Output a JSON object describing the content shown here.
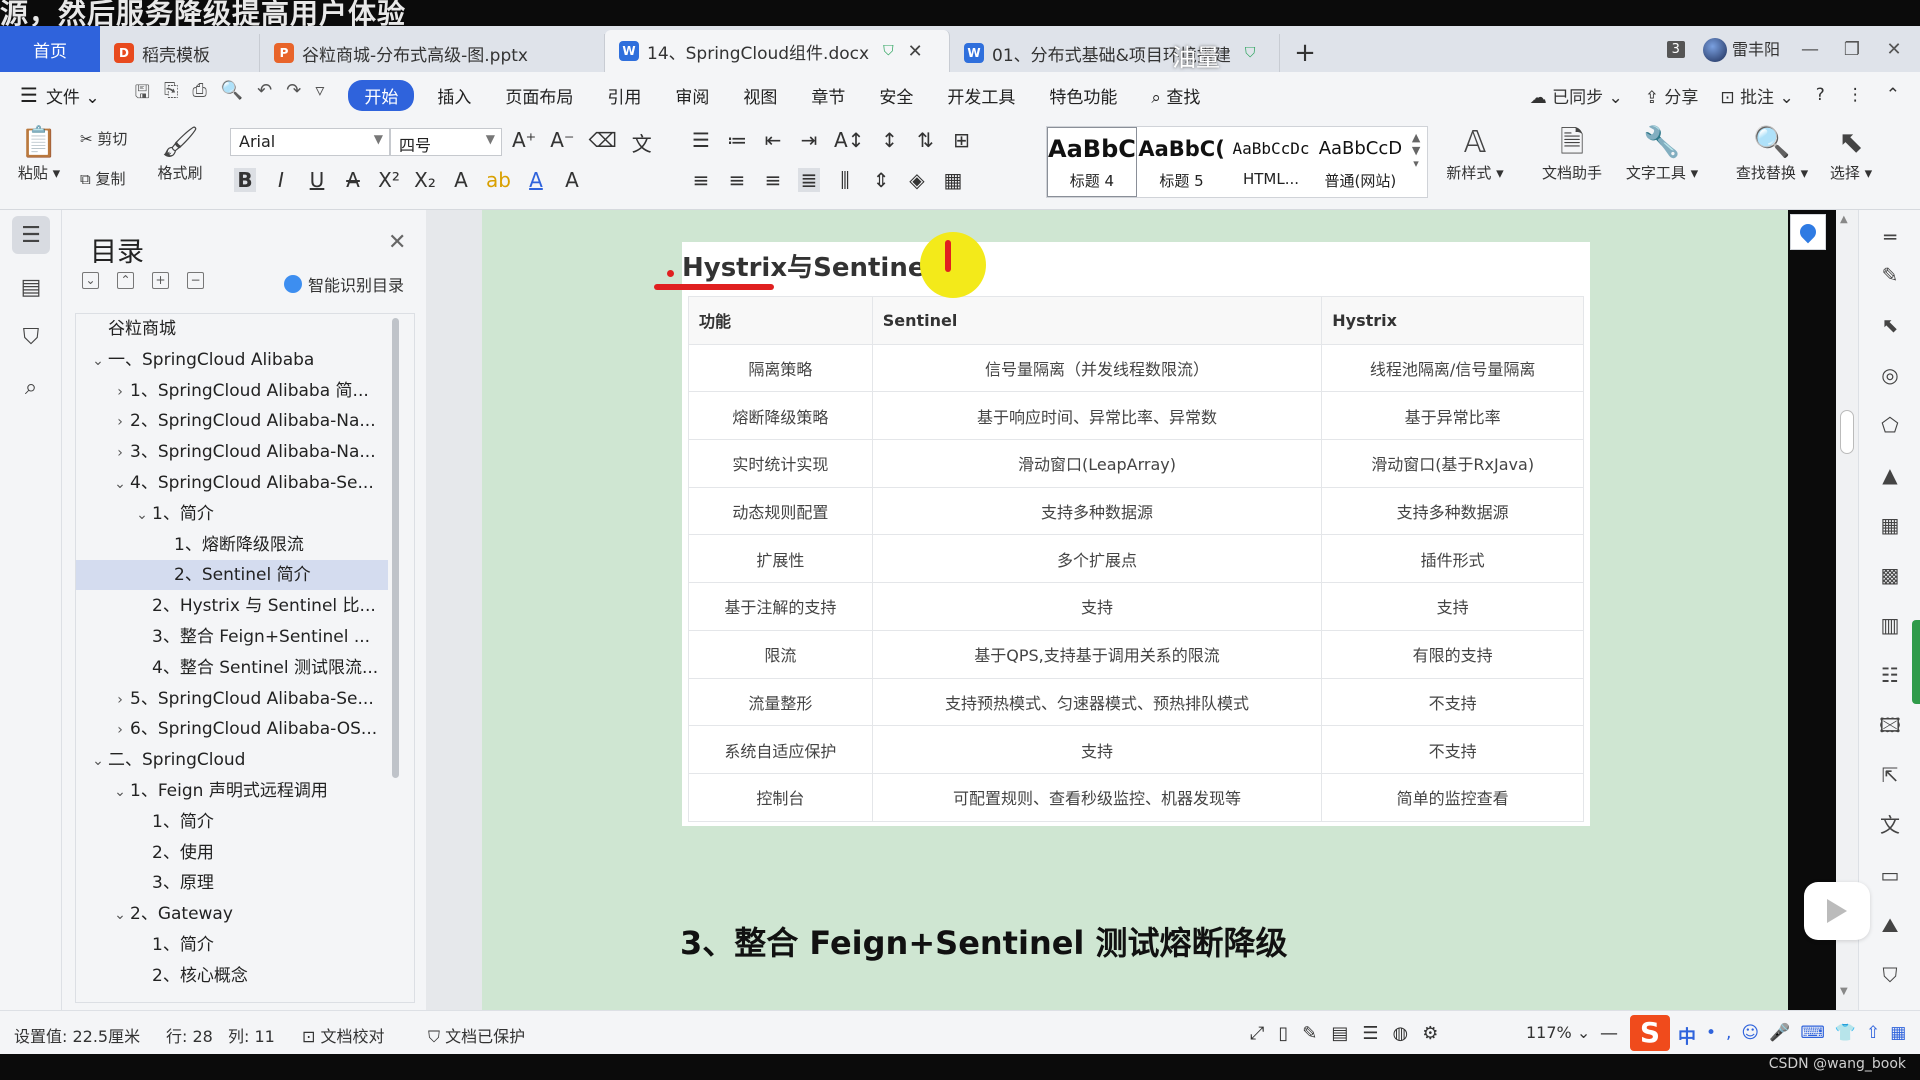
{
  "caption": "源，然后服务降级提高用户体验",
  "tabs": {
    "home": "首页",
    "items": [
      {
        "label": "稻壳模板",
        "icon": "docer-icon"
      },
      {
        "label": "谷粒商城-分布式高级-图.pptx",
        "icon": "ppt-icon"
      },
      {
        "label": "14、SpringCloud组件.docx",
        "icon": "word-icon",
        "active": true
      },
      {
        "label": "01、分布式基础&项目环境搭建",
        "icon": "word-icon"
      }
    ],
    "overlay": "油量",
    "window_count": "3",
    "user": "雷丰阳"
  },
  "menu": {
    "file": "文件",
    "items": [
      "开始",
      "插入",
      "页面布局",
      "引用",
      "审阅",
      "视图",
      "章节",
      "安全",
      "开发工具",
      "特色功能"
    ],
    "search": "查找",
    "synced": "已同步",
    "share": "分享",
    "comment": "批注",
    "help": "?"
  },
  "ribbon": {
    "paste": "粘贴",
    "cut": "剪切",
    "copy": "复制",
    "format_painter": "格式刷",
    "font_name": "Arial",
    "font_size": "四号",
    "styles": [
      {
        "sample": "AaBbC",
        "name": "标题 4"
      },
      {
        "sample": "AaBbC(",
        "name": "标题 5"
      },
      {
        "sample": "AaBbCcDc",
        "name": "HTML..."
      },
      {
        "sample": "AaBbCcD",
        "name": "普通(网站)"
      }
    ],
    "new_style": "新样式",
    "doc_assistant": "文档助手",
    "text_tools": "文字工具",
    "find_replace": "查找替换",
    "select": "选择"
  },
  "toc": {
    "title": "目录",
    "smart": "智能识别目录",
    "items": [
      {
        "text": "谷粒商城",
        "level": 0,
        "chev": ""
      },
      {
        "text": "一、SpringCloud Alibaba",
        "level": 0,
        "chev": "v"
      },
      {
        "text": "1、SpringCloud Alibaba 简...",
        "level": 1,
        "chev": ">"
      },
      {
        "text": "2、SpringCloud Alibaba-Na...",
        "level": 1,
        "chev": ">"
      },
      {
        "text": "3、SpringCloud Alibaba-Na...",
        "level": 1,
        "chev": ">"
      },
      {
        "text": "4、SpringCloud Alibaba-Se...",
        "level": 1,
        "chev": "v"
      },
      {
        "text": "1、简介",
        "level": 2,
        "chev": "v"
      },
      {
        "text": "1、熔断降级限流",
        "level": 3,
        "chev": ""
      },
      {
        "text": "2、Sentinel 简介",
        "level": 3,
        "chev": "",
        "selected": true
      },
      {
        "text": "2、Hystrix 与 Sentinel 比...",
        "level": 2,
        "chev": ""
      },
      {
        "text": "3、整合 Feign+Sentinel ...",
        "level": 2,
        "chev": ""
      },
      {
        "text": "4、整合 Sentinel 测试限流...",
        "level": 2,
        "chev": ""
      },
      {
        "text": "5、SpringCloud Alibaba-Se...",
        "level": 1,
        "chev": ">"
      },
      {
        "text": "6、SpringCloud Alibaba-OS...",
        "level": 1,
        "chev": ">"
      },
      {
        "text": "二、SpringCloud",
        "level": 0,
        "chev": "v"
      },
      {
        "text": "1、Feign 声明式远程调用",
        "level": 1,
        "chev": "v"
      },
      {
        "text": "1、简介",
        "level": 2,
        "chev": ""
      },
      {
        "text": "2、使用",
        "level": 2,
        "chev": ""
      },
      {
        "text": "3、原理",
        "level": 2,
        "chev": ""
      },
      {
        "text": "2、Gateway",
        "level": 1,
        "chev": "v"
      },
      {
        "text": "1、简介",
        "level": 2,
        "chev": ""
      },
      {
        "text": "2、核心概念",
        "level": 2,
        "chev": ""
      }
    ]
  },
  "document": {
    "heading": "Hystrix与Sentinel",
    "columns": [
      "功能",
      "Sentinel",
      "Hystrix"
    ],
    "rows": [
      [
        "隔离策略",
        "信号量隔离（并发线程数限流）",
        "线程池隔离/信号量隔离"
      ],
      [
        "熔断降级策略",
        "基于响应时间、异常比率、异常数",
        "基于异常比率"
      ],
      [
        "实时统计实现",
        "滑动窗口(LeapArray)",
        "滑动窗口(基于RxJava)"
      ],
      [
        "动态规则配置",
        "支持多种数据源",
        "支持多种数据源"
      ],
      [
        "扩展性",
        "多个扩展点",
        "插件形式"
      ],
      [
        "基于注解的支持",
        "支持",
        "支持"
      ],
      [
        "限流",
        "基于QPS,支持基于调用关系的限流",
        "有限的支持"
      ],
      [
        "流量整形",
        "支持预热模式、匀速器模式、预热排队模式",
        "不支持"
      ],
      [
        "系统自适应保护",
        "支持",
        "不支持"
      ],
      [
        "控制台",
        "可配置规则、查看秒级监控、机器发现等",
        "简单的监控查看"
      ]
    ],
    "section3": "3、整合 Feign+Sentinel 测试熔断降级"
  },
  "status": {
    "setting": "设置值: 22.5厘米",
    "row": "行: 28",
    "col": "列: 11",
    "proof": "文档校对",
    "protected": "文档已保护",
    "zoom": "117%",
    "ime_lang": "中"
  },
  "watermark": "CSDN @wang_book"
}
